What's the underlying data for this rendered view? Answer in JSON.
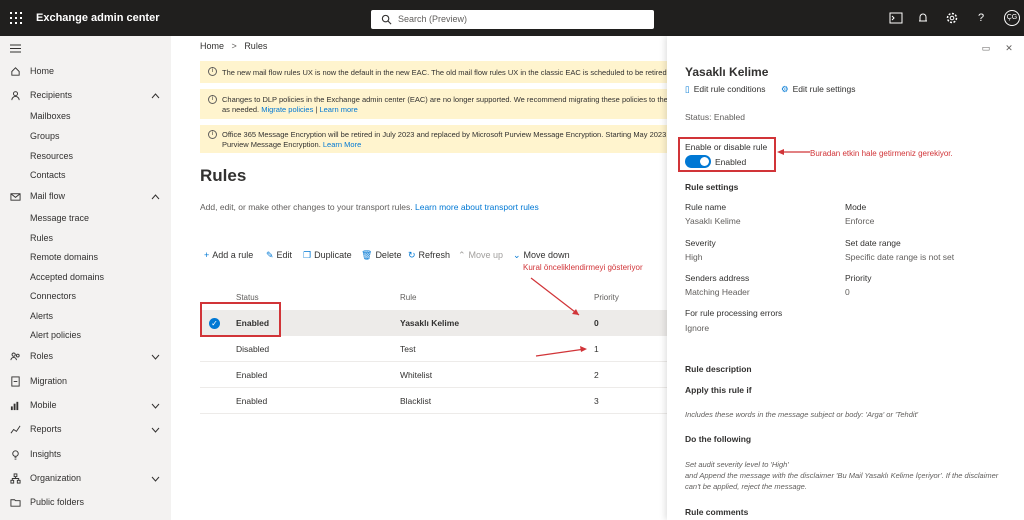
{
  "topbar": {
    "title": "Exchange admin center",
    "search_placeholder": "Search (Preview)",
    "avatar_initials": "ÇG",
    "help": "?"
  },
  "sidebar": {
    "items": [
      {
        "label": "Home",
        "icon": "home-icon"
      },
      {
        "label": "Recipients",
        "icon": "person-icon",
        "expanded": true
      },
      {
        "label": "Mailboxes",
        "sub": true
      },
      {
        "label": "Groups",
        "sub": true
      },
      {
        "label": "Resources",
        "sub": true
      },
      {
        "label": "Contacts",
        "sub": true
      },
      {
        "label": "Mail flow",
        "icon": "mail-icon",
        "expanded": true
      },
      {
        "label": "Message trace",
        "sub": true
      },
      {
        "label": "Rules",
        "sub": true
      },
      {
        "label": "Remote domains",
        "sub": true
      },
      {
        "label": "Accepted domains",
        "sub": true
      },
      {
        "label": "Connectors",
        "sub": true
      },
      {
        "label": "Alerts",
        "sub": true
      },
      {
        "label": "Alert policies",
        "sub": true
      },
      {
        "label": "Roles",
        "icon": "roles-icon",
        "expanded": false
      },
      {
        "label": "Migration",
        "icon": "migration-icon"
      },
      {
        "label": "Mobile",
        "icon": "mobile-icon",
        "expanded": false
      },
      {
        "label": "Reports",
        "icon": "reports-icon",
        "expanded": false
      },
      {
        "label": "Insights",
        "icon": "insights-icon"
      },
      {
        "label": "Organization",
        "icon": "organization-icon",
        "expanded": false
      },
      {
        "label": "Public folders",
        "icon": "public-folders-icon"
      }
    ]
  },
  "breadcrumb": {
    "home": "Home",
    "sep": ">",
    "current": "Rules"
  },
  "banners": [
    {
      "text": "The new mail flow rules UX is now the default in the new EAC. The old mail flow rules UX in the classic EAC is scheduled to be retired by the"
    },
    {
      "line1": "Changes to DLP policies in the Exchange admin center (EAC) are no longer supported. We recommend migrating these policies to the Micr",
      "line2_prefix": "as needed.",
      "link1": "Migrate policies",
      "sep": "|",
      "link2": "Learn more"
    },
    {
      "line1": "Office 365 Message Encryption will be retired in July 2023 and replaced by Microsoft Purview Message Encryption. Starting May 2023, all e",
      "line2_prefix": "Purview Message Encryption.",
      "link1": "Learn More"
    }
  ],
  "page": {
    "title": "Rules",
    "description": "Add, edit, or make other changes to your transport rules.",
    "description_link": "Learn more about transport rules"
  },
  "commands": {
    "add": "Add a rule",
    "edit": "Edit",
    "duplicate": "Duplicate",
    "delete": "Delete",
    "refresh": "Refresh",
    "move_up": "Move up",
    "move_down": "Move down"
  },
  "table": {
    "columns": [
      "Status",
      "Rule",
      "Priority"
    ],
    "rows": [
      {
        "status": "Enabled",
        "rule": "Yasaklı Kelime",
        "priority": "0",
        "selected": true
      },
      {
        "status": "Disabled",
        "rule": "Test",
        "priority": "1"
      },
      {
        "status": "Enabled",
        "rule": "Whitelist",
        "priority": "2"
      },
      {
        "status": "Enabled",
        "rule": "Blacklist",
        "priority": "3"
      }
    ]
  },
  "annotations": {
    "priority_note": "Kural önceliklendirmeyi gösteriyor",
    "toggle_note": "Buradan etkin hale getirmeniz gerekiyor."
  },
  "panel": {
    "title": "Yasaklı Kelime",
    "edit_conditions": "Edit rule conditions",
    "edit_settings": "Edit rule settings",
    "status": "Status: Enabled",
    "toggle_label": "Enable or disable rule",
    "toggle_state": "Enabled",
    "toggle_on": true,
    "settings_heading": "Rule settings",
    "fields": {
      "rule_name_label": "Rule name",
      "rule_name": "Yasaklı Kelime",
      "mode_label": "Mode",
      "mode": "Enforce",
      "severity_label": "Severity",
      "severity": "High",
      "set_date_label": "Set date range",
      "set_date": "Specific date range is not set",
      "senders_label": "Senders address",
      "senders": "Matching Header",
      "priority_label": "Priority",
      "priority": "0",
      "errors_label": "For rule processing errors",
      "errors": "Ignore"
    },
    "description_heading": "Rule description",
    "apply_heading": "Apply this rule if",
    "apply_text": "Includes these words in the message subject or body: 'Arga' or 'Tehdit'",
    "do_heading": "Do the following",
    "do_text_1": "Set audit severity level to 'High'",
    "do_text_2": "and Append the message with the disclaimer 'Bu Mail Yasaklı Kelime İçeriyor'. If the disclaimer can't be applied, reject the message.",
    "comments_heading": "Rule comments"
  },
  "colors": {
    "accent": "#0078d4",
    "annotation": "#d13438",
    "banner": "#fff4ce",
    "topbar": "#201f1e"
  }
}
